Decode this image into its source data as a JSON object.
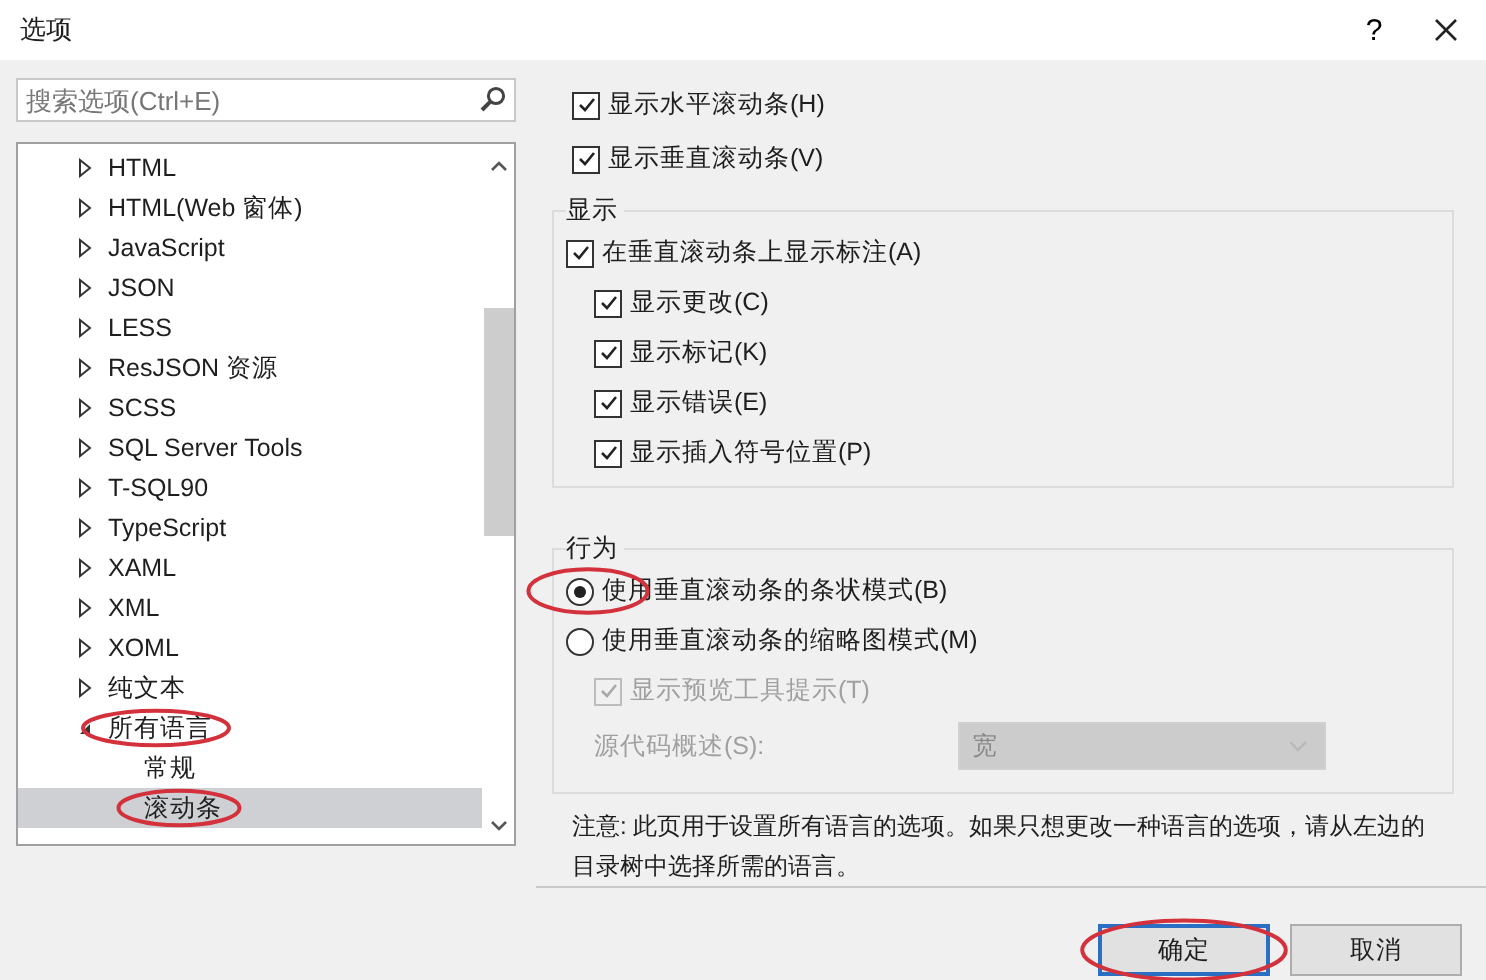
{
  "window": {
    "title": "选项",
    "help": "?"
  },
  "search": {
    "placeholder": "搜索选项(Ctrl+E)"
  },
  "tree": [
    {
      "label": "HTML",
      "expanded": false,
      "selected": false,
      "circled": false
    },
    {
      "label": "HTML(Web 窗体)",
      "expanded": false,
      "selected": false,
      "circled": false
    },
    {
      "label": "JavaScript",
      "expanded": false,
      "selected": false,
      "circled": false
    },
    {
      "label": "JSON",
      "expanded": false,
      "selected": false,
      "circled": false
    },
    {
      "label": "LESS",
      "expanded": false,
      "selected": false,
      "circled": false
    },
    {
      "label": "ResJSON 资源",
      "expanded": false,
      "selected": false,
      "circled": false
    },
    {
      "label": "SCSS",
      "expanded": false,
      "selected": false,
      "circled": false
    },
    {
      "label": "SQL Server Tools",
      "expanded": false,
      "selected": false,
      "circled": false
    },
    {
      "label": "T-SQL90",
      "expanded": false,
      "selected": false,
      "circled": false
    },
    {
      "label": "TypeScript",
      "expanded": false,
      "selected": false,
      "circled": false
    },
    {
      "label": "XAML",
      "expanded": false,
      "selected": false,
      "circled": false
    },
    {
      "label": "XML",
      "expanded": false,
      "selected": false,
      "circled": false
    },
    {
      "label": "XOML",
      "expanded": false,
      "selected": false,
      "circled": false
    },
    {
      "label": "纯文本",
      "expanded": false,
      "selected": false,
      "circled": false
    },
    {
      "label": "所有语言",
      "expanded": true,
      "selected": false,
      "circled": true,
      "children": [
        {
          "label": "常规",
          "selected": false,
          "circled": false
        },
        {
          "label": "滚动条",
          "selected": true,
          "circled": true
        }
      ]
    }
  ],
  "top_options": [
    {
      "label": "显示水平滚动条(H)",
      "checked": true,
      "disabled": false
    },
    {
      "label": "显示垂直滚动条(V)",
      "checked": true,
      "disabled": false
    }
  ],
  "display_group": {
    "title": "显示",
    "options": [
      {
        "label": "在垂直滚动条上显示标注(A)",
        "checked": true,
        "disabled": false,
        "children": [
          {
            "label": "显示更改(C)",
            "checked": true,
            "disabled": false
          },
          {
            "label": "显示标记(K)",
            "checked": true,
            "disabled": false
          },
          {
            "label": "显示错误(E)",
            "checked": true,
            "disabled": false
          },
          {
            "label": "显示插入符号位置(P)",
            "checked": true,
            "disabled": false
          }
        ]
      }
    ]
  },
  "behavior_group": {
    "title": "行为",
    "options": [
      {
        "label": "使用垂直滚动条的条状模式(B)",
        "selected": true,
        "circled": true
      },
      {
        "label": "使用垂直滚动条的缩略图模式(M)",
        "selected": false,
        "circled": false,
        "children": [
          {
            "kind": "checkbox",
            "label": "显示预览工具提示(T)",
            "checked": true,
            "disabled": true
          },
          {
            "kind": "dropdown",
            "label": "源代码概述(S):",
            "value": "宽",
            "disabled": true
          }
        ]
      }
    ]
  },
  "note": "注意: 此页用于设置所有语言的选项。如果只想更改一种语言的选项，请从左边的目录树中选择所需的语言。",
  "buttons": [
    {
      "label": "确定",
      "default": true,
      "circled": true
    },
    {
      "label": "取消",
      "default": false,
      "circled": false
    }
  ]
}
